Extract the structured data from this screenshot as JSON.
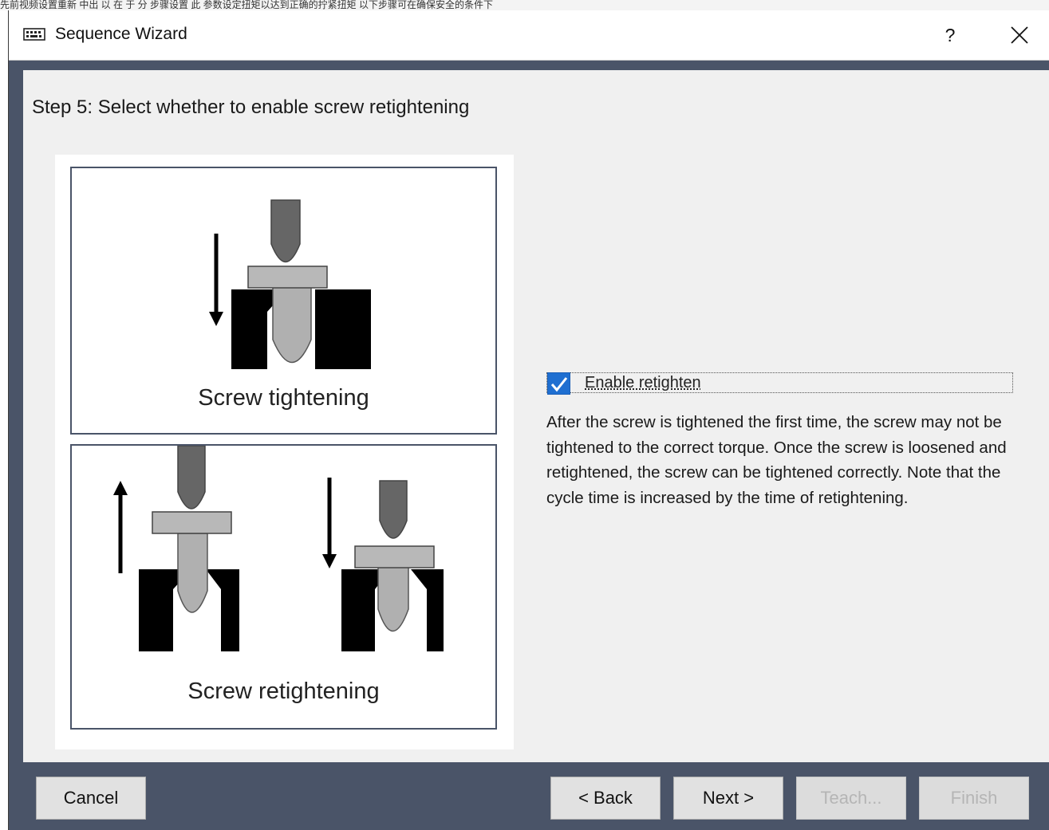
{
  "background_window": {
    "text": "先前视频设置重新 中出 以 在 于 分 步骤设置 此 参数设定扭矩以达到正确的拧紧扭矩 以下步骤可在确保安全的条件下"
  },
  "window": {
    "title": "Sequence Wizard",
    "help_label": "?",
    "icons": {
      "app": "keyboard-icon",
      "close": "close-icon"
    }
  },
  "step": {
    "title": "Step 5: Select whether to enable screw retightening"
  },
  "illustrations": {
    "tightening_caption": "Screw tightening",
    "retightening_caption": "Screw retightening"
  },
  "option": {
    "checkbox_label": "Enable retighten",
    "checked": true,
    "description": "After the screw is tightened the first time, the screw may not be tightened to the correct torque.  Once the screw is loosened and retightened, the screw can be tightened correctly. Note that the cycle time is increased by the time of retightening."
  },
  "buttons": {
    "cancel": "Cancel",
    "back": "< Back",
    "next": "Next >",
    "teach": "Teach...",
    "finish": "Finish"
  },
  "colors": {
    "frame": "#4a5468",
    "checkbox": "#1f6fd1",
    "screw_dark": "#666666",
    "screw_light": "#b0b0b0"
  }
}
